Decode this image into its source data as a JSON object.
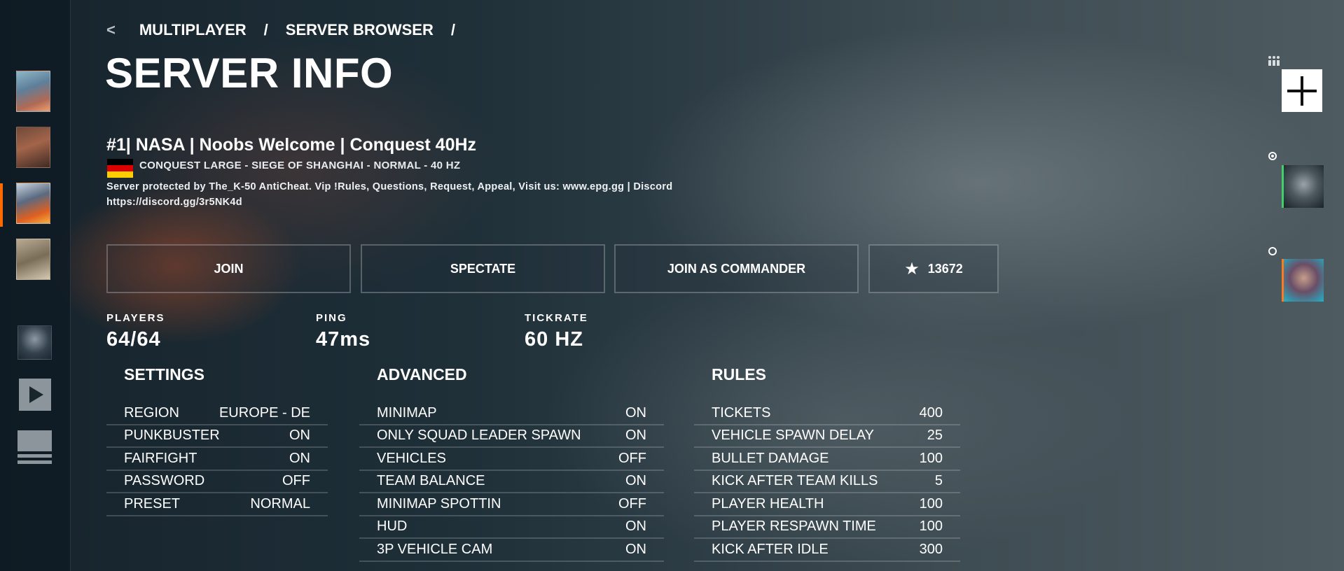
{
  "breadcrumb": {
    "back": "<",
    "items": [
      "MULTIPLAYER",
      "SERVER BROWSER"
    ],
    "separator": "/"
  },
  "page_title": "SERVER INFO",
  "server": {
    "name": "#1| NASA | Noobs Welcome | Conquest 40Hz",
    "mode_line": "CONQUEST LARGE - SIEGE OF SHANGHAI - NORMAL - 40 HZ",
    "description": "Server protected by The_K-50 AntiCheat. Vip !Rules, Questions, Request, Appeal, Visit us: www.epg.gg | Discord https://discord.gg/3r5NK4d",
    "flag_colors": [
      "#000000",
      "#dd0000",
      "#ffce00"
    ]
  },
  "actions": {
    "join": "JOIN",
    "spectate": "SPECTATE",
    "join_commander": "JOIN AS COMMANDER",
    "favorites": "13672",
    "favorites_icon": "star-icon"
  },
  "stats": {
    "players_label": "PLAYERS",
    "players_value": "64/64",
    "ping_label": "PING",
    "ping_value": "47ms",
    "tickrate_label": "TICKRATE",
    "tickrate_value": "60 HZ"
  },
  "settings": {
    "title": "SETTINGS",
    "rows": [
      {
        "k": "REGION",
        "v": "EUROPE - DE"
      },
      {
        "k": "PUNKBUSTER",
        "v": "ON"
      },
      {
        "k": "FAIRFIGHT",
        "v": "ON"
      },
      {
        "k": "PASSWORD",
        "v": "OFF"
      },
      {
        "k": "PRESET",
        "v": "NORMAL"
      }
    ]
  },
  "advanced": {
    "title": "ADVANCED",
    "rows": [
      {
        "k": "MINIMAP",
        "v": "ON"
      },
      {
        "k": "ONLY SQUAD LEADER SPAWN",
        "v": "ON"
      },
      {
        "k": "VEHICLES",
        "v": "OFF"
      },
      {
        "k": "TEAM BALANCE",
        "v": "ON"
      },
      {
        "k": "MINIMAP SPOTTIN",
        "v": "OFF"
      },
      {
        "k": "HUD",
        "v": "ON"
      },
      {
        "k": "3P VEHICLE CAM",
        "v": "ON"
      }
    ]
  },
  "rules": {
    "title": "RULES",
    "rows": [
      {
        "k": "TICKETS",
        "v": "400"
      },
      {
        "k": "VEHICLE SPAWN DELAY",
        "v": "25"
      },
      {
        "k": "BULLET DAMAGE",
        "v": "100"
      },
      {
        "k": "KICK AFTER TEAM KILLS",
        "v": "5"
      },
      {
        "k": "PLAYER HEALTH",
        "v": "100"
      },
      {
        "k": "PLAYER RESPAWN TIME",
        "v": "100"
      },
      {
        "k": "KICK AFTER IDLE",
        "v": "300"
      }
    ]
  },
  "colors": {
    "active_indicator": "#ff6a00",
    "friend_online": "#3fd06a",
    "friend_ingame": "#ff7a1a"
  }
}
